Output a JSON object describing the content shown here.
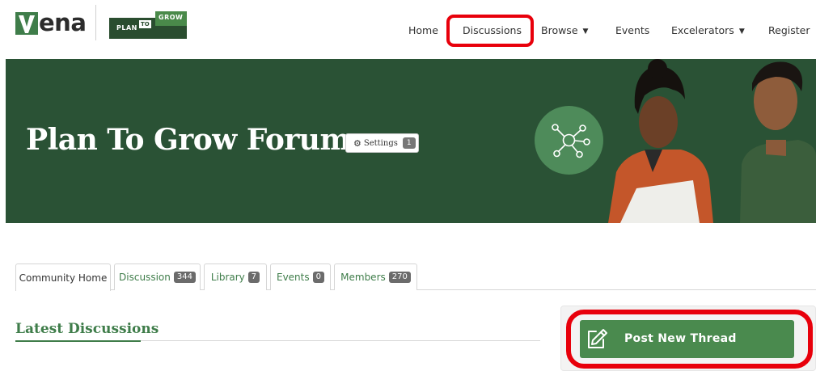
{
  "header": {
    "brand_word": "ena",
    "partner_logo": {
      "plan": "PLAN",
      "to": "TO",
      "grow": "GROW"
    },
    "nav": [
      {
        "label": "Home"
      },
      {
        "label": "Discussions",
        "highlighted": true
      },
      {
        "label": "Browse",
        "has_dropdown": true
      },
      {
        "label": "Events"
      },
      {
        "label": "Excelerators",
        "has_dropdown": true
      },
      {
        "label": "Register"
      }
    ]
  },
  "hero": {
    "title": "Plan To Grow Forum",
    "settings_label": "Settings",
    "settings_count": "1",
    "icon": "network-icon",
    "background_color": "#2a5235",
    "accent_circle_color": "#4e8b5a"
  },
  "tabs": [
    {
      "label": "Community Home",
      "active": true
    },
    {
      "label": "Discussion",
      "badge": "344"
    },
    {
      "label": "Library",
      "badge": "7"
    },
    {
      "label": "Events",
      "badge": "0"
    },
    {
      "label": "Members",
      "badge": "270"
    }
  ],
  "main": {
    "section_title": "Latest Discussions"
  },
  "sidebar": {
    "post_button_label": "Post New Thread",
    "post_button_icon": "edit-icon",
    "post_button_color": "#4a8a4e"
  },
  "colors": {
    "brand_green": "#3f7d4a",
    "highlight_red": "#e8000b"
  }
}
